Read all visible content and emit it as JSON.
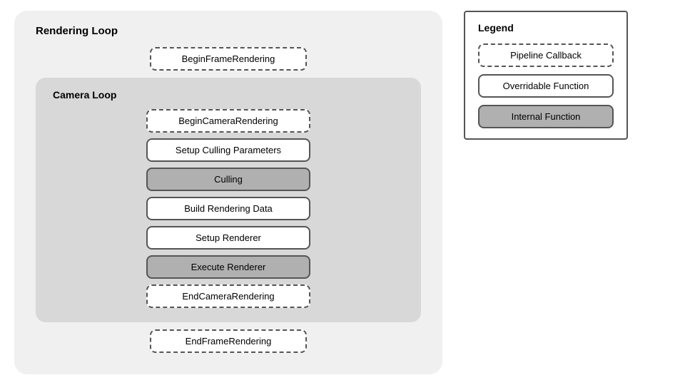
{
  "rendering_loop": {
    "title": "Rendering Loop",
    "begin_frame": "BeginFrameRendering",
    "end_frame": "EndFrameRendering",
    "camera_loop": {
      "title": "Camera Loop",
      "items": [
        {
          "label": "BeginCameraRendering",
          "type": "pipeline"
        },
        {
          "label": "Setup Culling Parameters",
          "type": "overridable"
        },
        {
          "label": "Culling",
          "type": "internal"
        },
        {
          "label": "Build Rendering Data",
          "type": "overridable"
        },
        {
          "label": "Setup Renderer",
          "type": "overridable"
        },
        {
          "label": "Execute Renderer",
          "type": "internal"
        },
        {
          "label": "EndCameraRendering",
          "type": "pipeline"
        }
      ]
    }
  },
  "legend": {
    "title": "Legend",
    "items": [
      {
        "label": "Pipeline Callback",
        "type": "pipeline"
      },
      {
        "label": "Overridable Function",
        "type": "overridable"
      },
      {
        "label": "Internal Function",
        "type": "internal"
      }
    ]
  }
}
